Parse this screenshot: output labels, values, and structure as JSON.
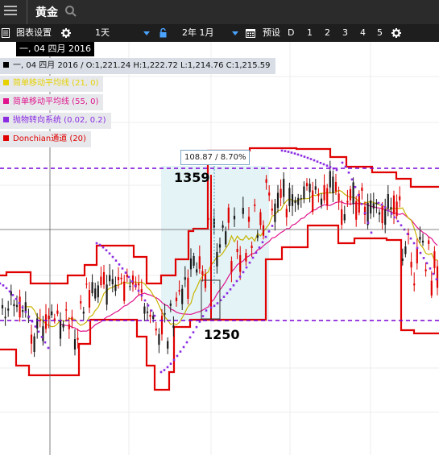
{
  "app": {
    "title": "黄金",
    "search_icon": "search-icon",
    "menu_icon": "menu-icon"
  },
  "toolbar": {
    "chart_settings_label": "图表设置",
    "period_value": "1天",
    "range_value": "2年 1月",
    "preset_label": "预设",
    "presets": [
      "D",
      "1",
      "2",
      "3",
      "4",
      "5"
    ],
    "accent_color": "#4aa3ff"
  },
  "crosshair": {
    "date_label": "一, 04 四月 2016"
  },
  "ohlc": {
    "text": "一, 04 四月 2016 / O:1,221.24  H:1,222.72  L:1,214.76  C:1,215.59"
  },
  "indicators": [
    {
      "label": "简单移动平均线 (21, 0)",
      "color": "#e6d200"
    },
    {
      "label": "简单移动平均线 (55, 0)",
      "color": "#e0148c"
    },
    {
      "label": "抛物转向系统 (0.02, 0.2)",
      "color": "#8b2be2"
    },
    {
      "label": "Donchian通道 (20)",
      "color": "#e00000"
    }
  ],
  "measure": {
    "tooltip": "108.87 / 8.70%",
    "high_label": "1359",
    "low_label": "1250"
  },
  "colors": {
    "donchian": "#e00000",
    "sma21": "#c8b400",
    "sma55": "#e0148c",
    "sar": "#8b2be2",
    "guide": "#7a00d6",
    "zone": "#e3f3f6",
    "candle": "#1a1a1a",
    "candle_up": "#e00000"
  }
}
